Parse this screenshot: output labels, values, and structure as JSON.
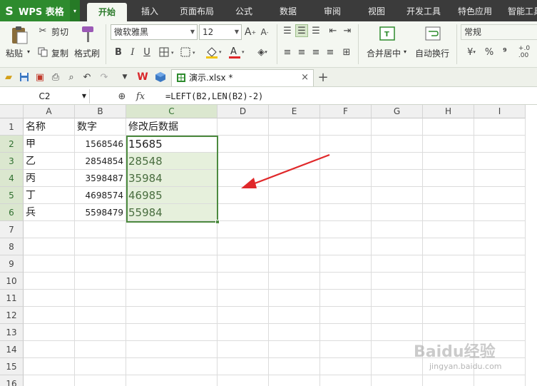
{
  "app": {
    "logo": "S",
    "name": "WPS 表格",
    "drop": "▾"
  },
  "menu_tabs": [
    "开始",
    "插入",
    "页面布局",
    "公式",
    "数据",
    "审阅",
    "视图",
    "开发工具",
    "特色应用",
    "智能工具"
  ],
  "ribbon": {
    "paste": "粘贴",
    "cut": "剪切",
    "copy": "复制",
    "format_painter": "格式刷",
    "font_name": "微软雅黑",
    "font_size": "12",
    "bold": "B",
    "italic": "I",
    "underline": "U",
    "merge_center": "合并居中",
    "wrap_text": "自动换行",
    "number_format": "常规",
    "percent": "%",
    "thousands": "⁹"
  },
  "doc_tab": {
    "title": "演示.xlsx *",
    "close": "×",
    "new": "+"
  },
  "formula_bar": {
    "cell_ref": "C2",
    "fx": "fx",
    "formula": "=LEFT(B2,LEN(B2)-2)"
  },
  "columns": [
    "A",
    "B",
    "C",
    "D",
    "E",
    "F",
    "G",
    "H",
    "I"
  ],
  "rows": [
    "1",
    "2",
    "3",
    "4",
    "5",
    "6",
    "7",
    "8",
    "9",
    "10",
    "11",
    "12",
    "13",
    "14",
    "15",
    "16"
  ],
  "table": {
    "headers": [
      "名称",
      "数字",
      "修改后数据"
    ],
    "names": [
      "甲",
      "乙",
      "丙",
      "丁",
      "兵"
    ],
    "numbers": [
      "1568546",
      "2854854",
      "3598487",
      "4698574",
      "5598479"
    ],
    "results": [
      "15685",
      "28548",
      "35984",
      "46985",
      "55984"
    ]
  },
  "watermark": {
    "brand": "Baidu经验",
    "url": "jingyan.baidu.com"
  },
  "colors": {
    "accent": "#2e8b2e",
    "selection_border": "#4c8a3f",
    "arrow": "#e0282a"
  }
}
